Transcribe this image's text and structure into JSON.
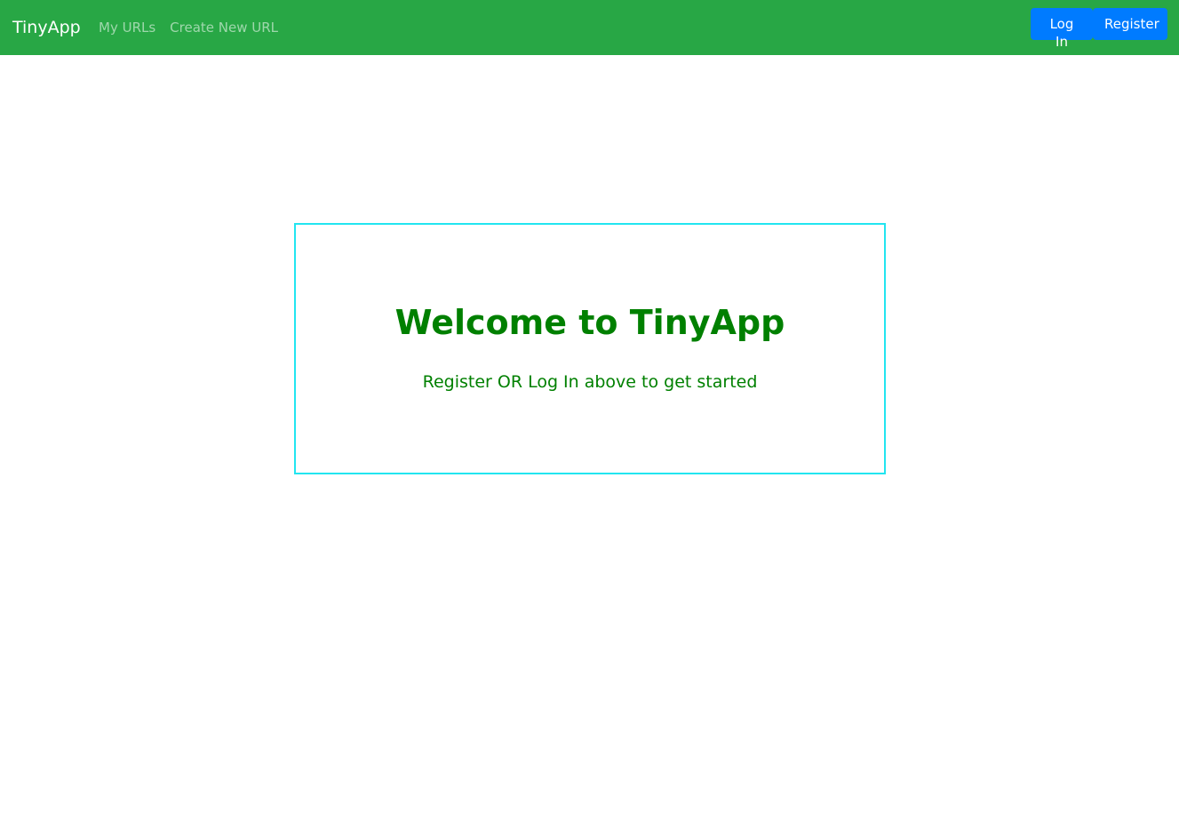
{
  "navbar": {
    "brand": "TinyApp",
    "links": [
      {
        "label": "My URLs"
      },
      {
        "label": "Create New URL"
      }
    ],
    "buttons": {
      "login": "Log In",
      "register": "Register"
    },
    "background_color": "#28a745",
    "button_color": "#007bff"
  },
  "main": {
    "title": "Welcome to TinyApp",
    "subtitle": "Register OR Log In above to get started",
    "text_color": "#008000",
    "box_border_color": "#22e5f0"
  }
}
